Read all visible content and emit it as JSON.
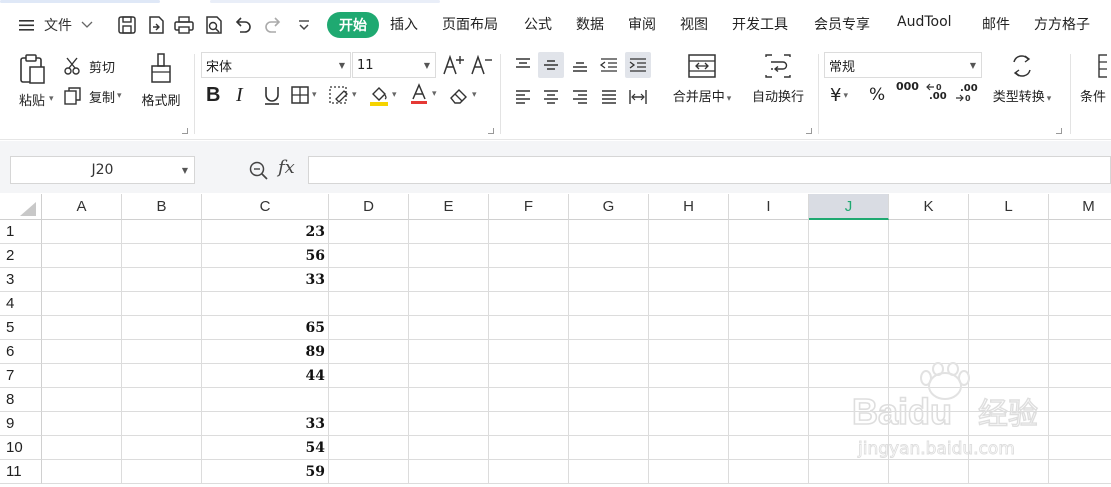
{
  "menu": {
    "file_label": "文件"
  },
  "tabs": [
    {
      "label": "开始"
    },
    {
      "label": "插入"
    },
    {
      "label": "页面布局"
    },
    {
      "label": "公式"
    },
    {
      "label": "数据"
    },
    {
      "label": "审阅"
    },
    {
      "label": "视图"
    },
    {
      "label": "开发工具"
    },
    {
      "label": "会员专享"
    },
    {
      "label": "AudTool"
    },
    {
      "label": "邮件"
    },
    {
      "label": "方方格子"
    }
  ],
  "ribbon": {
    "paste": "粘贴",
    "cut": "剪切",
    "copy": "复制",
    "format_painter": "格式刷",
    "font_name": "宋体",
    "font_size": "11",
    "merge_center": "合并居中",
    "wrap_text": "自动换行",
    "number_format": "常规",
    "type_convert": "类型转换",
    "conditional": "条件",
    "currency_symbol": "¥",
    "percent_symbol": "%",
    "thousands_symbol": "000",
    "inc_decimal": ".00",
    "dec_decimal": ".00"
  },
  "formula_bar": {
    "name_box": "J20",
    "fx": "fx",
    "formula": ""
  },
  "grid": {
    "columns": [
      "A",
      "B",
      "C",
      "D",
      "E",
      "F",
      "G",
      "H",
      "I",
      "J",
      "K",
      "L",
      "M"
    ],
    "active_column": "J",
    "rows": [
      "1",
      "2",
      "3",
      "4",
      "5",
      "6",
      "7",
      "8",
      "9",
      "10",
      "11"
    ],
    "column_c_values": [
      "23",
      "56",
      "33",
      "",
      "65",
      "89",
      "44",
      "",
      "33",
      "54",
      "59"
    ]
  },
  "watermark": {
    "brand": "Baidu",
    "brand_cn": "经验",
    "url": "jingyan.baidu.com"
  },
  "colors": {
    "accent": "#1fa971",
    "font_color_bar": "#e53935",
    "fill_color_bar": "#f5d300"
  }
}
